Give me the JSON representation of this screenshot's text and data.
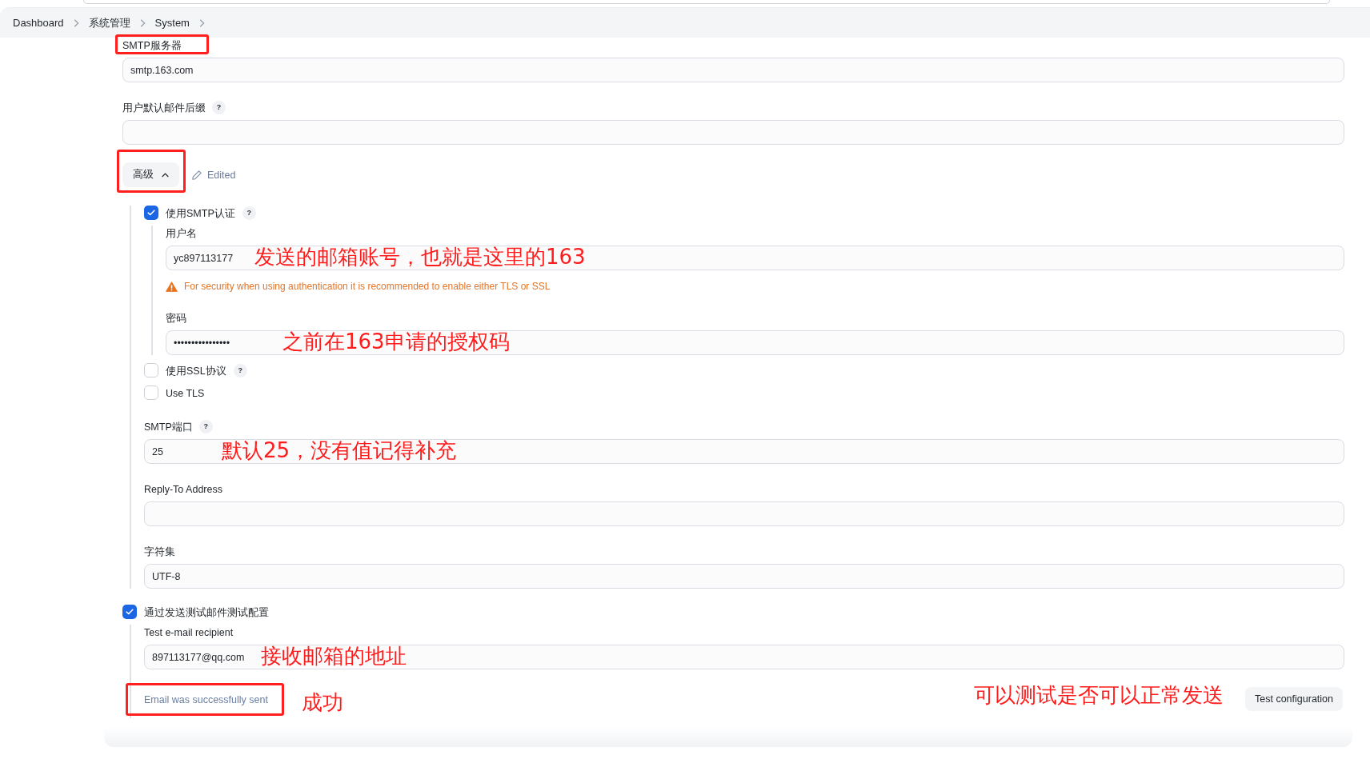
{
  "breadcrumbs": [
    "Dashboard",
    "系统管理",
    "System"
  ],
  "form": [
    {
      "kind": "text",
      "label": "SMTP服务器",
      "highlighted": true,
      "value": "smtp.163.com"
    },
    {
      "kind": "text",
      "label": "用户默认邮件后缀",
      "help": "?"
    },
    {
      "kind": "advanced",
      "label": "高级",
      "expanded": true,
      "highlighted": true,
      "edited": "Edited",
      "children": [
        {
          "kind": "checkbox",
          "label": "使用SMTP认证",
          "help": "?",
          "checked": true,
          "children": [
            {
              "kind": "text",
              "label": "用户名",
              "value": "yc897113177",
              "annotation": "发送的邮箱账号，也就是这里的163"
            },
            {
              "kind": "warning",
              "text": "For security when using authentication it is recommended to enable either TLS or SSL"
            },
            {
              "kind": "text",
              "label": "密码",
              "value": "••••••••••••••••",
              "annotation": "之前在163申请的授权码"
            }
          ]
        },
        {
          "kind": "checkbox",
          "label": "使用SSL协议",
          "help": "?",
          "checked": false
        },
        {
          "kind": "checkbox",
          "label": "Use TLS",
          "checked": false
        },
        {
          "kind": "text",
          "label": "SMTP端口",
          "help": "?",
          "value": "25",
          "annotation": "默认25，没有值记得补充"
        },
        {
          "kind": "text",
          "label": "Reply-To Address"
        },
        {
          "kind": "text",
          "label": "字符集",
          "value": "UTF-8"
        }
      ]
    },
    {
      "kind": "checkbox",
      "label": "通过发送测试邮件测试配置",
      "checked": true,
      "children": [
        {
          "kind": "text",
          "label": "Test e-mail recipient",
          "value": "897113177@qq.com",
          "annotation": "接收邮箱的地址"
        },
        {
          "kind": "validate",
          "status": "Email was successfully sent",
          "highlighted": true,
          "annotation": "成功",
          "button_annotation": "可以测试是否可以正常发送",
          "button": "Test configuration"
        }
      ]
    }
  ]
}
